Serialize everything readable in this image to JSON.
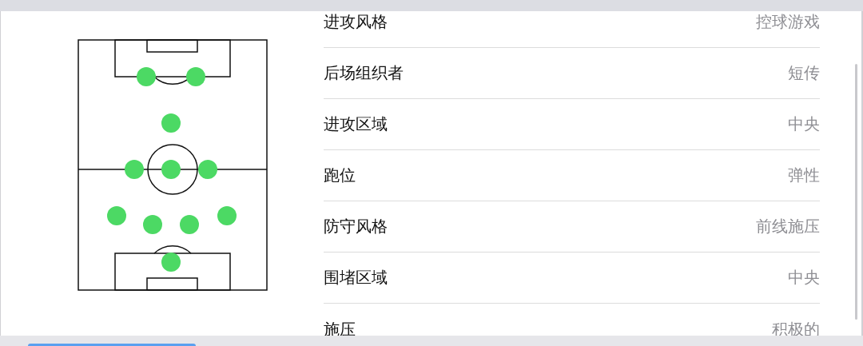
{
  "tactics": [
    {
      "label": "进攻风格",
      "value": "控球游戏"
    },
    {
      "label": "后场组织者",
      "value": "短传"
    },
    {
      "label": "进攻区域",
      "value": "中央"
    },
    {
      "label": "跑位",
      "value": "弹性"
    },
    {
      "label": "防守风格",
      "value": "前线施压"
    },
    {
      "label": "围堵区域",
      "value": "中央"
    },
    {
      "label": "施压",
      "value": "积极的"
    }
  ]
}
